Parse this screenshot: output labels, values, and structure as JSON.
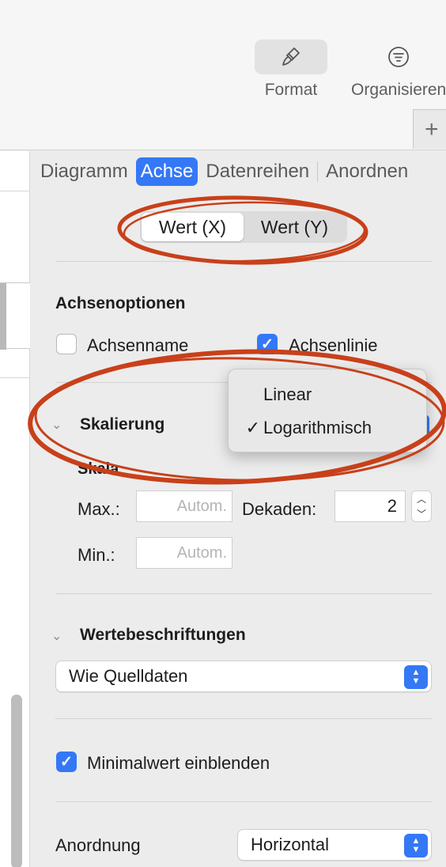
{
  "toolbar": {
    "format_label": "Format",
    "organize_label": "Organisieren",
    "add_label": "+"
  },
  "tabs": [
    {
      "label": "Diagramm",
      "active": false
    },
    {
      "label": "Achse",
      "active": true
    },
    {
      "label": "Datenreihen",
      "active": false
    },
    {
      "label": "Anordnen",
      "active": false
    }
  ],
  "axis_segment": {
    "items": [
      "Wert (X)",
      "Wert (Y)"
    ],
    "selected": "Wert (X)"
  },
  "axis_options": {
    "title": "Achsenoptionen",
    "axis_name_label": "Achsenname",
    "axis_name_checked": false,
    "axis_line_label": "Achsenlinie",
    "axis_line_checked": true
  },
  "scaling": {
    "title": "Skalierung",
    "sub_label": "Skala",
    "max_label": "Max.:",
    "max_placeholder": "Autom.",
    "decades_label": "Dekaden:",
    "decades_value": "2",
    "min_label": "Min.:",
    "min_placeholder": "Autom.",
    "menu": {
      "items": [
        "Linear",
        "Logarithmisch"
      ],
      "selected": "Logarithmisch",
      "check_glyph": "✓"
    }
  },
  "value_labels": {
    "title": "Wertebeschriftungen",
    "selected": "Wie Quelldaten"
  },
  "show_minimum": {
    "label": "Minimalwert einblenden",
    "checked": true
  },
  "arrangement": {
    "label": "Anordnung",
    "selected": "Horizontal"
  },
  "colors": {
    "accent": "#3478f6",
    "annotation": "#c8401a"
  }
}
